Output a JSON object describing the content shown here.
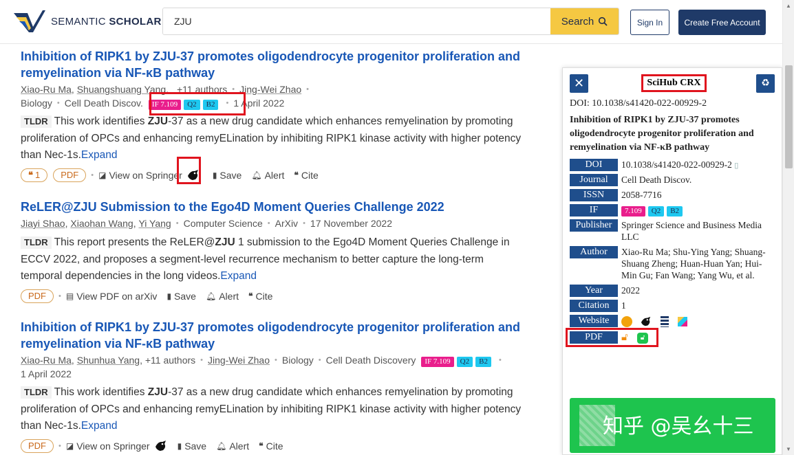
{
  "header": {
    "logo_text_light": "SEMANTIC ",
    "logo_text_bold": "SCHOLAR",
    "search_value": "ZJU",
    "search_button": "Search",
    "signin": "Sign In",
    "create_account": "Create Free Account"
  },
  "results": [
    {
      "title": "Inhibition of RIPK1 by ZJU-37 promotes oligodendrocyte progenitor proliferation and remyelination via NF-κB pathway",
      "authors": [
        "Xiao-Ru Ma",
        "Shuangshuang Yang"
      ],
      "more_authors": "+11 authors",
      "last_author": "Jing-Wei Zhao",
      "field": "Biology",
      "venue": "Cell Death Discov.",
      "if_badge": "IF 7.109",
      "q_badge": "Q2",
      "b_badge": "B2",
      "date": "1 April 2022",
      "tldr_tag": "TLDR",
      "tldr_before": "This work identifies ",
      "tldr_bold": "ZJU",
      "tldr_after": "-37 as a new drug candidate which enhances remyelination by promoting proliferation of OPCs and enhancing remyELination by inhibiting RIPK1 kinase activity with higher potency than Nec-1s.",
      "expand": "Expand",
      "cite_count": "1",
      "pdf": "PDF",
      "view": "View on Springer",
      "save": "Save",
      "alert": "Alert",
      "cite": "Cite"
    },
    {
      "title": "ReLER@ZJU Submission to the Ego4D Moment Queries Challenge 2022",
      "authors": [
        "Jiayi Shao",
        "Xiaohan Wang",
        "Yi Yang"
      ],
      "field": "Computer Science",
      "venue": "ArXiv",
      "date": "17 November 2022",
      "tldr_tag": "TLDR",
      "tldr_before": "This report presents the ReLER@",
      "tldr_bold": "ZJU",
      "tldr_after": " 1 submission to the Ego4D Moment Queries Challenge in ECCV 2022, and proposes a segment-level recurrence mechanism to better capture the long-term temporal dependencies in the long videos.",
      "expand": "Expand",
      "pdf": "PDF",
      "view": "View PDF on arXiv",
      "save": "Save",
      "alert": "Alert",
      "cite": "Cite"
    },
    {
      "title": "Inhibition of RIPK1 by ZJU-37 promotes oligodendrocyte progenitor proliferation and remyelination via NF-κB pathway",
      "authors": [
        "Xiao-Ru Ma",
        "Shunhua Yang"
      ],
      "more_authors": "+11 authors",
      "last_author": "Jing-Wei Zhao",
      "field": "Biology",
      "venue": "Cell Death Discovery",
      "if_badge": "IF 7.109",
      "q_badge": "Q2",
      "b_badge": "B2",
      "date": "1 April 2022",
      "tldr_tag": "TLDR",
      "tldr_before": "This work identifies ",
      "tldr_bold": "ZJU",
      "tldr_after": "-37 as a new drug candidate which enhances remyelination by promoting proliferation of OPCs and enhancing remyELination by inhibiting RIPK1 kinase activity with higher potency than Nec-1s.",
      "expand": "Expand",
      "pdf": "PDF",
      "view": "View on Springer",
      "save": "Save",
      "alert": "Alert",
      "cite": "Cite"
    }
  ],
  "panel": {
    "title": "SciHub CRX",
    "doi_line": "DOI: 10.1038/s41420-022-00929-2",
    "paper_title": "Inhibition of RIPK1 by ZJU-37 promotes oligodendrocyte progenitor proliferation and remyelination via NF-κB pathway",
    "rows": {
      "doi": {
        "label": "DOI",
        "value": "10.1038/s41420-022-00929-2"
      },
      "journal": {
        "label": "Journal",
        "value": "Cell Death Discov."
      },
      "issn": {
        "label": "ISSN",
        "value": "2058-7716"
      },
      "if": {
        "label": "IF",
        "if_badge": "7.109",
        "q_badge": "Q2",
        "b_badge": "B2"
      },
      "publisher": {
        "label": "Publisher",
        "value": "Springer Science and Business Media LLC"
      },
      "author": {
        "label": "Author",
        "value": "Xiao-Ru Ma; Shu-Ying Yang; Shuang-Shuang Zheng; Huan-Huan Yan; Hui-Min Gu; Fan Wang; Yang Wu, et al."
      },
      "year": {
        "label": "Year",
        "value": "2022"
      },
      "citation": {
        "label": "Citation",
        "value": "1"
      },
      "website": {
        "label": "Website"
      },
      "pdf": {
        "label": "PDF"
      }
    },
    "watermark": "知乎 @吴幺十三"
  },
  "colors": {
    "brand_blue": "#1f3a68",
    "link_blue": "#1857b6",
    "search_yellow": "#f5c842",
    "if_pink": "#e91e8c",
    "quartile_cyan": "#1ec8f0",
    "highlight_red": "#e0141e",
    "panel_label_blue": "#1f4e8c"
  }
}
